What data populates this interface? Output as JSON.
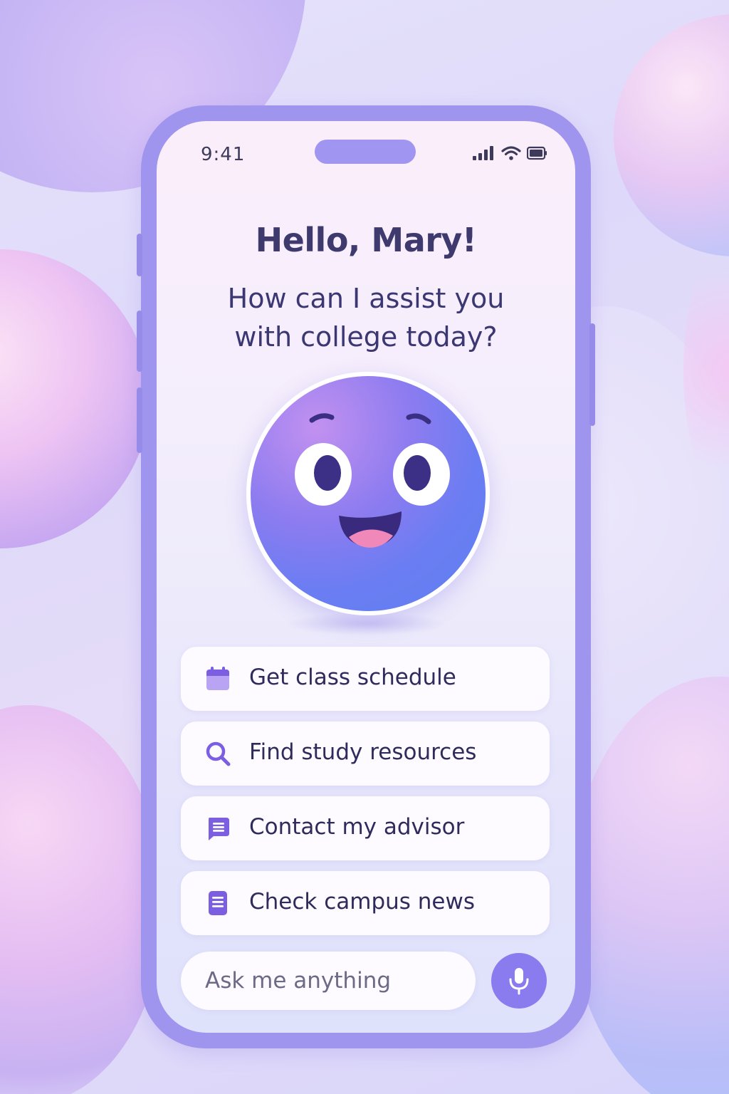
{
  "status_bar": {
    "time": "9:41",
    "icons": [
      "signal-icon",
      "wifi-icon",
      "battery-icon"
    ]
  },
  "greeting": {
    "title": "Hello, Mary!",
    "subtitle": "How can I assist you with college today?"
  },
  "avatar": {
    "icon": "smiling-face-mascot"
  },
  "actions": [
    {
      "label": "Get class schedule",
      "icon": "calendar-icon"
    },
    {
      "label": "Find study resources",
      "icon": "search-icon"
    },
    {
      "label": "Contact my advisor",
      "icon": "chat-icon"
    },
    {
      "label": "Check campus news",
      "icon": "document-icon"
    }
  ],
  "input": {
    "placeholder": "Ask me anything",
    "value": ""
  },
  "mic_button": {
    "icon": "microphone-icon"
  },
  "colors": {
    "accent": "#8a7cef",
    "phone_frame": "#9f95ee",
    "text_dark": "#3f3a6e"
  }
}
